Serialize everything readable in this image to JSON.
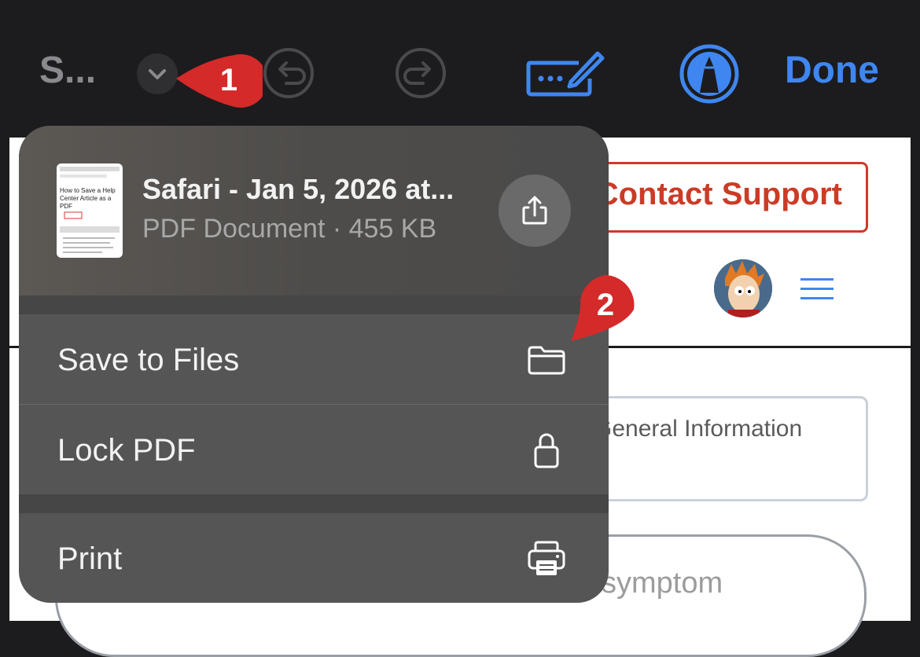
{
  "toolbar": {
    "title": "S...",
    "done_label": "Done",
    "chevron_icon": "chevron-down-icon",
    "undo_icon": "undo-icon",
    "redo_icon": "redo-icon",
    "keyboard_pen_icon": "keyboard-pen-icon",
    "markup_icon": "markup-pen-icon"
  },
  "annotations": {
    "badge_1": "1",
    "badge_2": "2",
    "color": "#d42a2a"
  },
  "background_page": {
    "contact_support": "Contact Support",
    "general_info": "General Information",
    "symptom_placeholder": "symptom"
  },
  "menu": {
    "doc_title": "Safari - Jan 5, 2026 at...",
    "doc_meta": "PDF Document · 455 KB",
    "thumbnail_text": "How to Save a Help Center Article as a PDF",
    "share_icon": "share-icon",
    "items": [
      {
        "label": "Save to Files",
        "icon": "folder-icon"
      },
      {
        "label": "Lock PDF",
        "icon": "lock-icon"
      },
      {
        "label": "Print",
        "icon": "printer-icon"
      }
    ]
  },
  "colors": {
    "accent": "#3f86f0",
    "support_red": "#cc3b26",
    "menu_bg": "#555555",
    "toolbar_bg": "#1c1c1e"
  }
}
